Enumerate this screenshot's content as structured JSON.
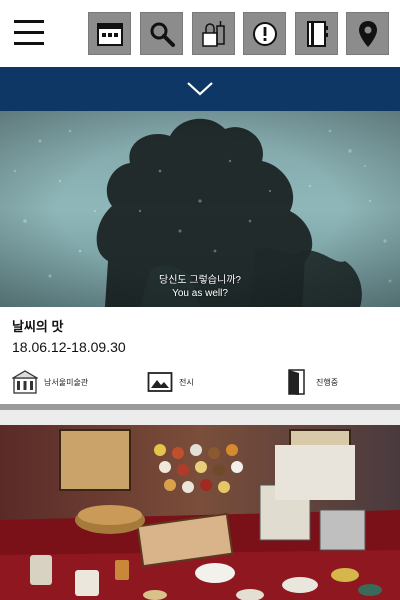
{
  "header": {
    "menu_icon": "hamburger-menu-icon",
    "icons": [
      {
        "name": "calendar-icon"
      },
      {
        "name": "search-icon"
      },
      {
        "name": "lock-key-icon"
      },
      {
        "name": "alert-icon"
      },
      {
        "name": "notebook-icon"
      },
      {
        "name": "map-pin-icon"
      }
    ],
    "accent_color": "#0f3766",
    "icon_bg_color": "#8c8c8c"
  },
  "expand_bar": {
    "icon": "chevron-down-icon"
  },
  "cards": [
    {
      "image_caption_ko": "당신도 그렇습니까?",
      "image_caption_en": "You as well?",
      "title": "날씨의 맛",
      "dates": "18.06.12-18.09.30",
      "venue_icon": "museum-building-icon",
      "venue": "남서울미술관",
      "type_icon": "exhibition-picture-icon",
      "type": "전시",
      "status_icon": "door-icon",
      "status": "진행중"
    },
    {
      "image": "exhibition-photo"
    }
  ]
}
